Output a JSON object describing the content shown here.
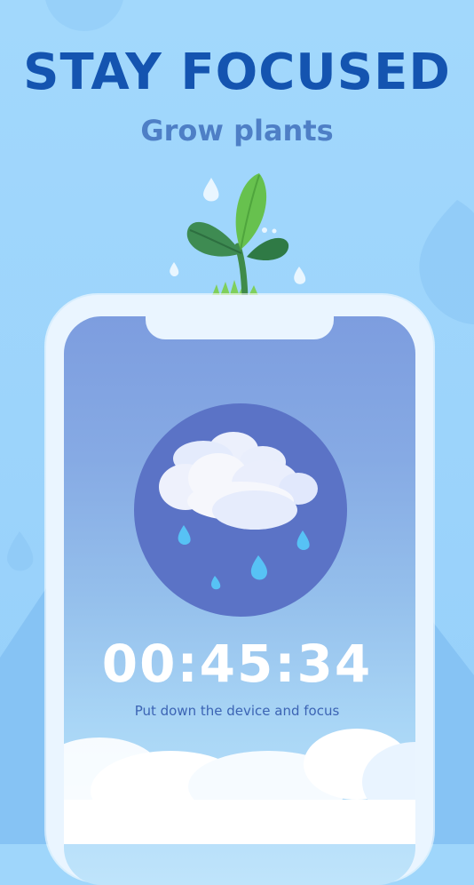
{
  "header": {
    "title": "STAY FOCUSED",
    "subtitle": "Grow plants"
  },
  "timer": {
    "value": "00:45:34",
    "hint": "Put down the device and focus"
  },
  "icons": {
    "plant": "sprout-icon",
    "weather": "rain-cloud-icon"
  },
  "colors": {
    "title": "#1454b0",
    "subtitle": "#4e7fc6",
    "background": "#9fd6fb",
    "circle": "#5b73c6",
    "hint": "#3c64b4"
  }
}
